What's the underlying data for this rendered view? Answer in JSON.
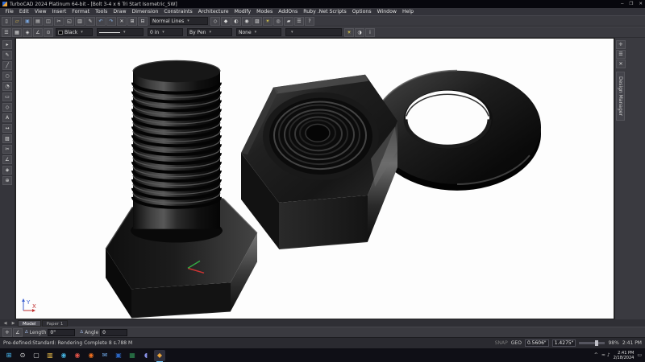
{
  "colors": {
    "chrome_bg": "#3a3a40",
    "canvas_bg": "#fdfdfd",
    "taskbar_bg": "#0f0f16",
    "accent_blue": "#4cc2ff"
  },
  "titlebar": {
    "title": "TurboCAD 2024 Platinum 64-bit - [Bolt 3-4 x 6 Tri Start Isometric_SW]",
    "minimize": "─",
    "maximize": "❐",
    "close": "✕"
  },
  "menubar": {
    "items": [
      {
        "name": "menu-file",
        "label": "File"
      },
      {
        "name": "menu-edit",
        "label": "Edit"
      },
      {
        "name": "menu-view",
        "label": "View"
      },
      {
        "name": "menu-insert",
        "label": "Insert"
      },
      {
        "name": "menu-format",
        "label": "Format"
      },
      {
        "name": "menu-tools",
        "label": "Tools"
      },
      {
        "name": "menu-draw",
        "label": "Draw"
      },
      {
        "name": "menu-dimension",
        "label": "Dimension"
      },
      {
        "name": "menu-constraints",
        "label": "Constraints"
      },
      {
        "name": "menu-architecture",
        "label": "Architecture"
      },
      {
        "name": "menu-modify",
        "label": "Modify"
      },
      {
        "name": "menu-modes",
        "label": "Modes"
      },
      {
        "name": "menu-addons",
        "label": "AddOns"
      },
      {
        "name": "menu-ruby-net-scripts",
        "label": "Ruby .Net Scripts"
      },
      {
        "name": "menu-options",
        "label": "Options"
      },
      {
        "name": "menu-window",
        "label": "Window"
      },
      {
        "name": "menu-help",
        "label": "Help"
      }
    ],
    "mdi_minimize": "─",
    "mdi_restore": "❐",
    "mdi_close": "✕"
  },
  "toolbar_main": {
    "icons_left": [
      {
        "name": "new-icon",
        "glyph": "▯"
      },
      {
        "name": "open-icon",
        "glyph": "▱",
        "color": "#e8c24a"
      },
      {
        "name": "save-icon",
        "glyph": "▣",
        "color": "#7aa7e0"
      },
      {
        "name": "print-icon",
        "glyph": "▤"
      },
      {
        "name": "print-preview-icon",
        "glyph": "◫"
      },
      {
        "name": "cut-icon",
        "glyph": "✂"
      },
      {
        "name": "copy-icon",
        "glyph": "◱"
      },
      {
        "name": "paste-icon",
        "glyph": "▥"
      },
      {
        "name": "format-brush-icon",
        "glyph": "✎"
      },
      {
        "name": "undo-icon",
        "glyph": "↶",
        "color": "#8ab4e8"
      },
      {
        "name": "redo-icon",
        "glyph": "↷",
        "color": "#8ab4e8"
      },
      {
        "name": "delete-icon",
        "glyph": "✕"
      },
      {
        "name": "group-icon",
        "glyph": "⊞"
      },
      {
        "name": "explode-icon",
        "glyph": "⊟"
      }
    ],
    "line_style_dropdown": "Normal Lines",
    "icons_right": [
      {
        "name": "wireframe-icon",
        "glyph": "◇"
      },
      {
        "name": "hidden-line-icon",
        "glyph": "◆"
      },
      {
        "name": "draft-render-icon",
        "glyph": "◐"
      },
      {
        "name": "quality-render-icon",
        "glyph": "◉"
      },
      {
        "name": "materials-icon",
        "glyph": "▨"
      },
      {
        "name": "lights-icon",
        "glyph": "☀",
        "color": "#e8d44a"
      },
      {
        "name": "camera-icon",
        "glyph": "◎"
      },
      {
        "name": "workplane-icon",
        "glyph": "▰"
      },
      {
        "name": "properties-icon",
        "glyph": "☰"
      },
      {
        "name": "help-icon",
        "glyph": "?"
      }
    ]
  },
  "toolbar_properties": {
    "icons_left": [
      {
        "name": "layers-icon",
        "glyph": "☰"
      },
      {
        "name": "grid-icon",
        "glyph": "▦"
      },
      {
        "name": "snap-magnet-icon",
        "glyph": "◈"
      },
      {
        "name": "ortho-icon",
        "glyph": "∠"
      },
      {
        "name": "osnap-icon",
        "glyph": "⊙"
      }
    ],
    "color_value": "Black",
    "width_value": "0 in",
    "pen_value": "By Pen",
    "hatch_value": "None",
    "icons_right": [
      {
        "name": "lightbulb-icon",
        "glyph": "☀",
        "color": "#e8d44a"
      },
      {
        "name": "render-settings-icon",
        "glyph": "◑"
      },
      {
        "name": "info-icon",
        "glyph": "i"
      }
    ]
  },
  "left_toolbar": {
    "icons": [
      {
        "name": "select-tool-icon",
        "glyph": "▸"
      },
      {
        "name": "pen-tool-icon",
        "glyph": "✎"
      },
      {
        "name": "line-tool-icon",
        "glyph": "╱"
      },
      {
        "name": "circle-tool-icon",
        "glyph": "○"
      },
      {
        "name": "arc-tool-icon",
        "glyph": "◔"
      },
      {
        "name": "rect-tool-icon",
        "glyph": "▭"
      },
      {
        "name": "polygon-tool-icon",
        "glyph": "◇"
      },
      {
        "name": "text-tool-icon",
        "glyph": "A"
      },
      {
        "name": "dimension-tool-icon",
        "glyph": "↔"
      },
      {
        "name": "hatch-tool-icon",
        "glyph": "▨"
      },
      {
        "name": "trim-tool-icon",
        "glyph": "✂"
      },
      {
        "name": "measure-tool-icon",
        "glyph": "∠"
      },
      {
        "name": "snap-tool-icon",
        "glyph": "◈"
      },
      {
        "name": "zoom-tool-icon",
        "glyph": "⊕"
      }
    ]
  },
  "right_panel": {
    "icons": [
      {
        "name": "pin-icon",
        "glyph": "✛"
      },
      {
        "name": "panel-menu-icon",
        "glyph": "☰"
      },
      {
        "name": "panel-close-icon",
        "glyph": "✕"
      }
    ],
    "tab_label": "Design Manager"
  },
  "canvas": {
    "axis_x": "X",
    "axis_y": "Y"
  },
  "sheet_tabs": {
    "nav_prev": "◀",
    "nav_next": "▶",
    "tabs": [
      {
        "name": "tab-model",
        "label": "Model",
        "active": true
      },
      {
        "name": "tab-paper-1",
        "label": "Paper 1",
        "active": false
      }
    ]
  },
  "coordinate_bar": {
    "icons": [
      {
        "name": "coord-lock-icon",
        "glyph": "✛"
      },
      {
        "name": "coord-angle-icon",
        "glyph": "∠"
      }
    ],
    "fields": [
      {
        "name": "length-field",
        "label": "Length",
        "value": "0\""
      },
      {
        "name": "angle-field",
        "label": "Angle",
        "value": "0"
      }
    ]
  },
  "statusbar": {
    "message": "Pre-defined:Standard: Rendering Complete 8 s.788 M",
    "snap_label": "SNAP",
    "geo_label": "GEO",
    "x_value": "0.5606\"",
    "y_value": "1.4275\"",
    "zoom_value": "98%",
    "time": "2:41 PM"
  },
  "taskbar": {
    "icons": [
      {
        "name": "start-button",
        "glyph": "⊞",
        "color": "#4cc2ff"
      },
      {
        "name": "search-button",
        "glyph": "⊙",
        "color": "#e8e8e8"
      },
      {
        "name": "task-view-button",
        "glyph": "▢",
        "color": "#cfcfcf"
      },
      {
        "name": "file-explorer-icon",
        "glyph": "▥",
        "color": "#f0c14b"
      },
      {
        "name": "edge-icon",
        "glyph": "◉",
        "color": "#45b3e0"
      },
      {
        "name": "chrome-icon",
        "glyph": "◉",
        "color": "#e8554a"
      },
      {
        "name": "firefox-icon",
        "glyph": "◉",
        "color": "#f0701f"
      },
      {
        "name": "outlook-icon",
        "glyph": "✉",
        "color": "#6fa8e8"
      },
      {
        "name": "word-icon",
        "glyph": "▣",
        "color": "#2b66c2"
      },
      {
        "name": "excel-icon",
        "glyph": "▦",
        "color": "#2e8c52"
      },
      {
        "name": "discord-icon",
        "glyph": "◖",
        "color": "#8a93e8"
      },
      {
        "name": "turbocad-taskbar-icon",
        "glyph": "◆",
        "color": "#e8a23a",
        "active": true
      }
    ],
    "tray": {
      "chevron": "^",
      "icons": [
        {
          "name": "network-icon",
          "glyph": "≈"
        },
        {
          "name": "volume-icon",
          "glyph": "♪"
        }
      ],
      "time": "2:41 PM",
      "date": "2/18/2024",
      "notification": "▭"
    }
  }
}
